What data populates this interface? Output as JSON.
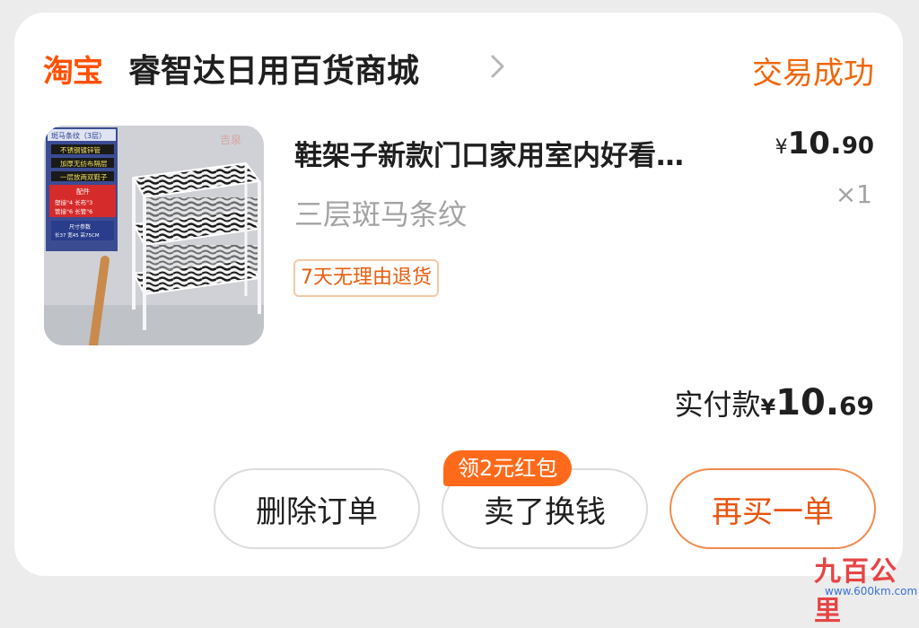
{
  "order": {
    "shop_logo": "淘宝",
    "shop_name": "睿智达日用百货商城",
    "status": "交易成功"
  },
  "product": {
    "title": "鞋架子新款门口家用室内好看…",
    "sku": "三层斑马条纹",
    "tag": "7天无理由退货",
    "price_symbol": "¥",
    "price_int": "10.",
    "price_dec": "90",
    "quantity": "×1",
    "image_labels": {
      "header": "斑马条纹（3层）",
      "line1": "不锈钢镀锌管",
      "line2": "加厚无纺布隔层",
      "line3": "一层放两双鞋子",
      "parts_title": "配件",
      "parts1": "塑接\"4 长布\"3",
      "parts2": "管接\"6 长管\"6",
      "size_title": "尺寸参数",
      "size": "长37 宽45 高75CM",
      "brand": "吉泉"
    }
  },
  "payment": {
    "label": "实付款",
    "symbol": "¥",
    "int": "10.",
    "dec": "69"
  },
  "actions": {
    "delete": "删除订单",
    "sell": "卖了换钱",
    "promo": "领2元红包",
    "rebuy": "再买一单"
  },
  "watermark": {
    "main": "九百公里",
    "sub": "www.600km.com"
  },
  "colors": {
    "brand": "#ff5000",
    "status": "#f0660a",
    "accent": "#e8540c"
  }
}
